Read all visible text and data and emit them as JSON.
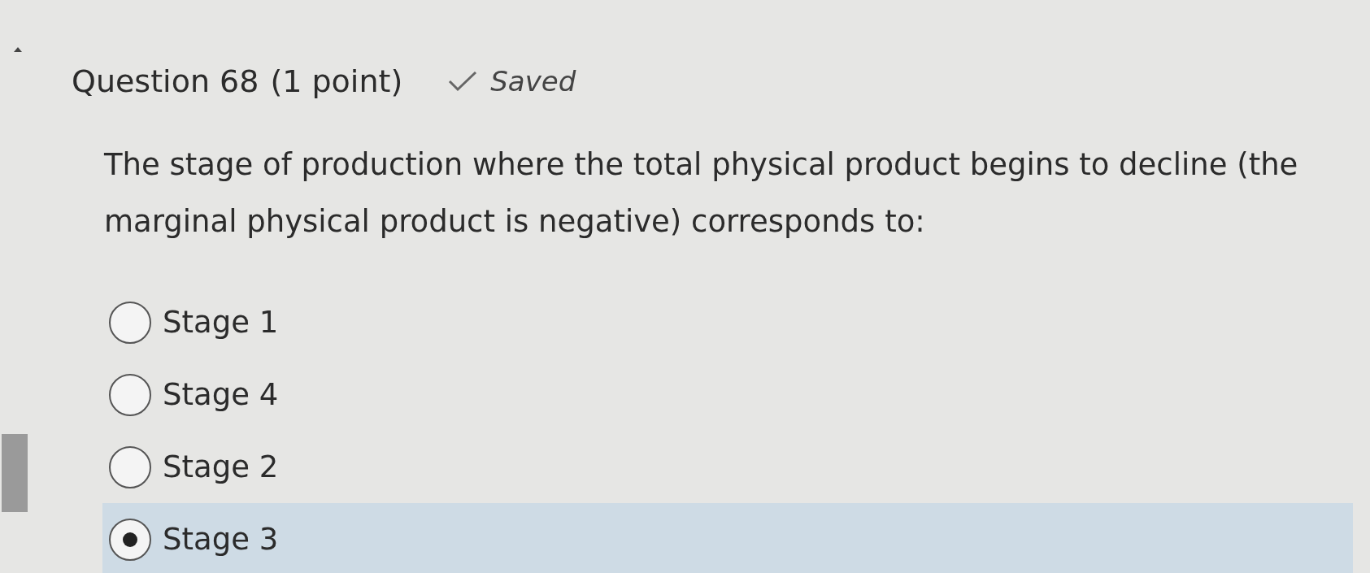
{
  "question": {
    "title": "Question 68",
    "points": "(1 point)",
    "status": "Saved",
    "saved": true,
    "text": "The stage of production where the total physical product begins to decline (the marginal physical product is negative) corresponds to:"
  },
  "options": [
    {
      "label": "Stage 1",
      "selected": false
    },
    {
      "label": "Stage 4",
      "selected": false
    },
    {
      "label": "Stage 2",
      "selected": false
    },
    {
      "label": "Stage 3",
      "selected": true
    }
  ]
}
